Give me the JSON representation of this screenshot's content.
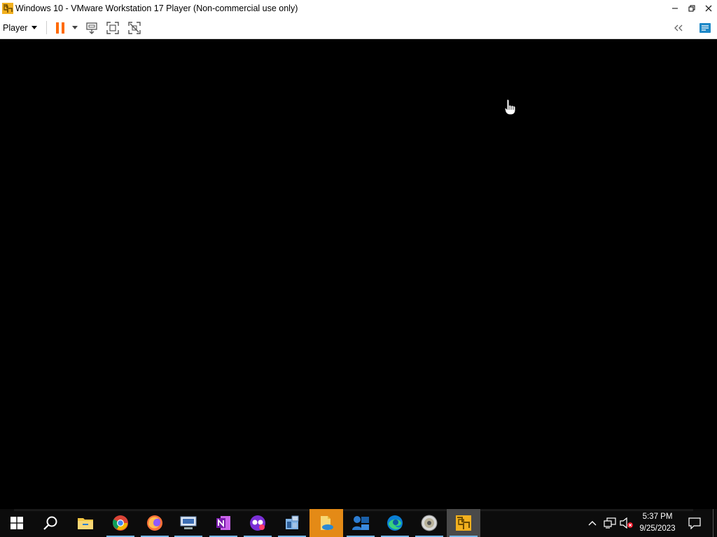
{
  "window": {
    "title": "Windows 10 - VMware Workstation 17 Player (Non-commercial use only)",
    "controls": [
      "minimize",
      "restore",
      "close"
    ]
  },
  "toolbar": {
    "player_menu_label": "Player",
    "buttons": [
      "pause-icon",
      "send-ctrl-alt-del-icon",
      "full-screen-icon",
      "unity-icon"
    ],
    "right_buttons": [
      "collapse-toolbar-icon",
      "notes-icon"
    ],
    "accent": "#ff6a00"
  },
  "taskbar": {
    "apps": [
      {
        "name": "file-explorer",
        "icon": "folder-icon"
      },
      {
        "name": "chrome",
        "icon": "chrome-icon"
      },
      {
        "name": "firefox",
        "icon": "firefox-icon"
      },
      {
        "name": "network-app",
        "icon": "network-icon"
      },
      {
        "name": "onenote",
        "icon": "onenote-icon"
      },
      {
        "name": "media-app",
        "icon": "media-icon"
      },
      {
        "name": "registry-app",
        "icon": "registry-icon"
      },
      {
        "name": "notes-app",
        "icon": "notes-app-icon"
      },
      {
        "name": "user-app",
        "icon": "user-icon"
      },
      {
        "name": "edge",
        "icon": "edge-icon"
      },
      {
        "name": "disc-app",
        "icon": "disc-icon"
      },
      {
        "name": "vmware",
        "icon": "vmware-icon"
      }
    ],
    "clock": {
      "time": "5:37 PM",
      "date": "9/25/2023"
    },
    "tray_icons": [
      "chevron-up-icon",
      "network-icon",
      "volume-muted-icon",
      "notification-icon"
    ]
  }
}
